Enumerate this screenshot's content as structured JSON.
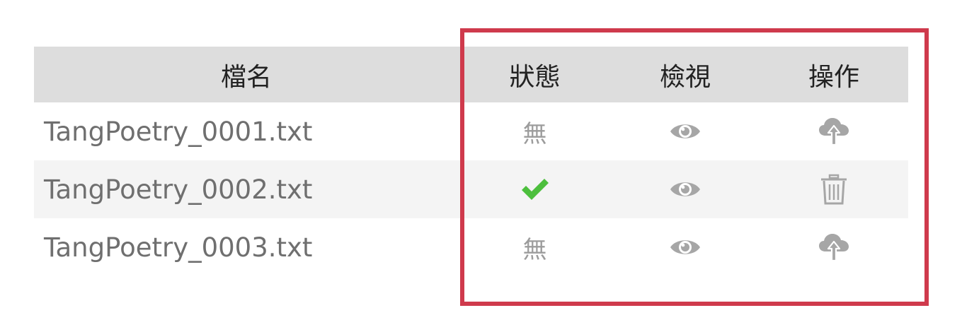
{
  "table": {
    "headers": {
      "filename": "檔名",
      "status": "狀態",
      "view": "檢視",
      "action": "操作"
    },
    "rows": [
      {
        "filename": "TangPoetry_0001.txt",
        "status": "none",
        "status_text": "無",
        "view_icon": "eye-icon",
        "action_icon": "cloud-upload-icon"
      },
      {
        "filename": "TangPoetry_0002.txt",
        "status": "done",
        "status_icon": "checkmark-icon",
        "view_icon": "eye-icon",
        "action_icon": "trash-icon"
      },
      {
        "filename": "TangPoetry_0003.txt",
        "status": "none",
        "status_text": "無",
        "view_icon": "eye-icon",
        "action_icon": "cloud-upload-icon"
      }
    ]
  },
  "colors": {
    "highlight_border": "#cf3a4c",
    "header_background": "#dddddd",
    "alt_row_background": "#f4f4f4",
    "check_green": "#4cbf3d",
    "icon_gray": "#a6a6a6"
  }
}
